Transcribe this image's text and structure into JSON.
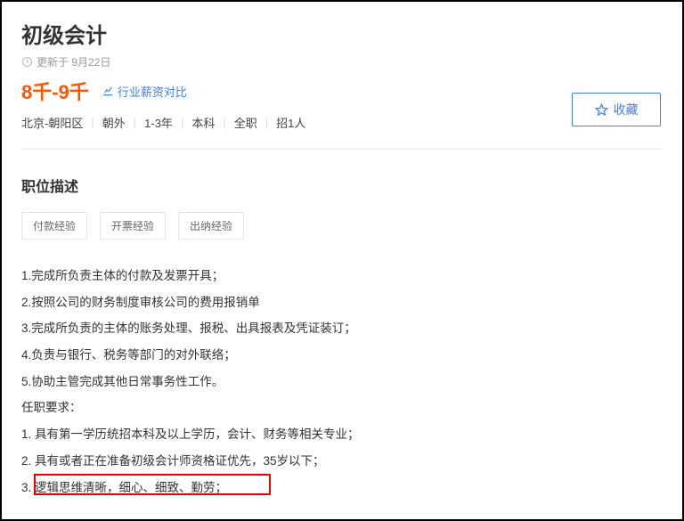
{
  "job": {
    "title": "初级会计",
    "update_text": "更新于 9月22日",
    "salary": "8千-9千",
    "compare_label": "行业薪资对比",
    "meta": {
      "location": "北京-朝阳区",
      "area": "朝外",
      "experience": "1-3年",
      "education": "本科",
      "type": "全职",
      "headcount": "招1人"
    },
    "favorite_label": "收藏"
  },
  "description": {
    "section_title": "职位描述",
    "tags": [
      "付款经验",
      "开票经验",
      "出纳经验"
    ],
    "duties": [
      "1.完成所负责主体的付款及发票开具；",
      "2.按照公司的财务制度审核公司的费用报销单",
      "3.完成所负责的主体的账务处理、报税、出具报表及凭证装订；",
      "4.负责与银行、税务等部门的对外联络；",
      "5.协助主管完成其他日常事务性工作。"
    ],
    "requirements_title": "任职要求：",
    "requirements": [
      {
        "prefix": "1. ",
        "text": "具有第一学历统招本科及以上学历，会计、财务等相关专业；"
      },
      {
        "prefix": "2. ",
        "highlighted": "具有或者正在准备初级会计师资格证优先",
        "suffix": "，35岁以下；"
      },
      {
        "prefix": "3. ",
        "text": "逻辑思维清晰，细心、细致、勤劳；"
      }
    ]
  }
}
